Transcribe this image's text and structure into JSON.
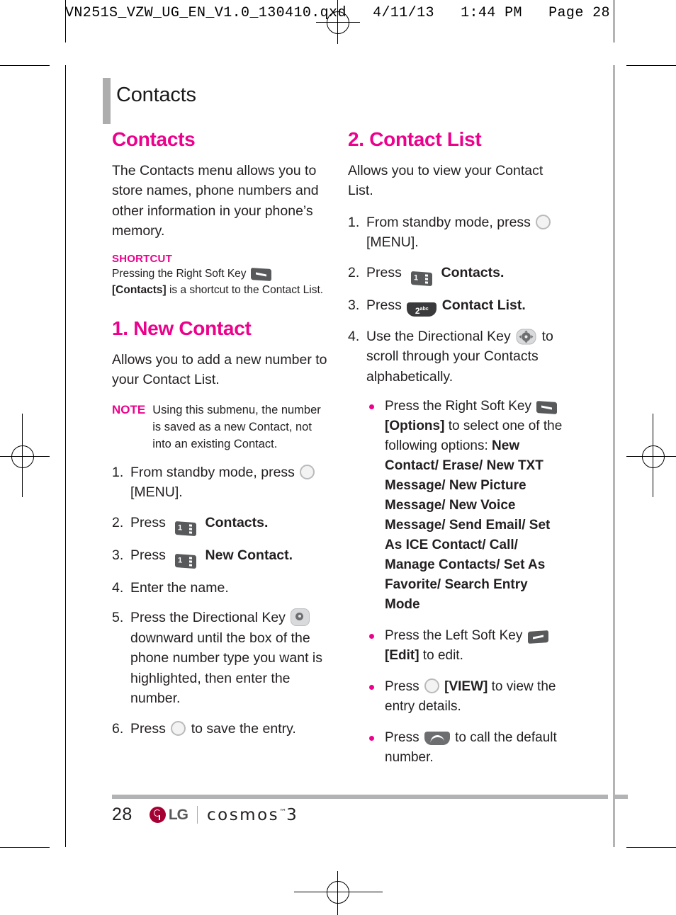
{
  "prepress": {
    "header": "VN251S_VZW_UG_EN_V1.0_130410.qxd   4/11/13   1:44 PM   Page 28"
  },
  "chapter": {
    "title": "Contacts"
  },
  "left_column": {
    "section_title": "Contacts",
    "intro": "The Contacts menu allows you to store names, phone numbers and other information in your phone’s memory.",
    "shortcut": {
      "label": "SHORTCUT",
      "text_before": "Pressing the Right Soft Key",
      "key_icon": "right-soft-key-icon",
      "bracket": "[Contacts]",
      "text_after": "is a shortcut to the Contact List."
    },
    "new_contact": {
      "heading": "1. New Contact",
      "intro": "Allows you to add a new number to your Contact List.",
      "note_label": "NOTE",
      "note_text": "Using this submenu, the number is saved as a new Contact, not into an existing Contact.",
      "steps": [
        {
          "num": "1.",
          "text_before": "From standby mode, press",
          "icon": "ok-key-icon",
          "text_after": "[MENU].",
          "bold_after": false
        },
        {
          "num": "2.",
          "text_before": "Press",
          "icon": "numeric-key-1-icon",
          "text_after": "Contacts.",
          "bold_after": true
        },
        {
          "num": "3.",
          "text_before": "Press",
          "icon": "numeric-key-1-icon",
          "text_after": "New Contact.",
          "bold_after": true
        },
        {
          "num": "4.",
          "text_before": "Enter the name.",
          "icon": "",
          "text_after": "",
          "bold_after": false
        },
        {
          "num": "5.",
          "text_before": "Press the Directional Key",
          "icon": "directional-key-icon",
          "text_after": "downward until the box of the phone number type you want is highlighted, then enter the number.",
          "bold_after": false
        },
        {
          "num": "6.",
          "text_before": "Press",
          "icon": "ok-key-icon",
          "text_after": "to save the entry.",
          "bold_after": false
        }
      ]
    }
  },
  "right_column": {
    "contact_list": {
      "heading": "2. Contact List",
      "intro": "Allows you to view your Contact List.",
      "steps": [
        {
          "num": "1.",
          "text_before": "From standby mode, press",
          "icon": "ok-key-icon",
          "text_after": "[MENU].",
          "bold_after": false
        },
        {
          "num": "2.",
          "text_before": "Press",
          "icon": "numeric-key-1-icon",
          "text_after": "Contacts.",
          "bold_after": true
        },
        {
          "num": "3.",
          "text_before": "Press",
          "icon": "numeric-key-2abc-icon",
          "text_after": "Contact List.",
          "bold_after": true
        },
        {
          "num": "4.",
          "text_before": "Use the Directional Key",
          "icon": "directional-key-4way-icon",
          "text_after": "to scroll through your Contacts alphabetically.",
          "bold_after": false
        }
      ],
      "bullets": [
        {
          "text_before": "Press the Right Soft Key",
          "icon": "right-soft-key-icon",
          "bracket": "[Options]",
          "text_after": "to select one of the following options:",
          "options_bold": "New Contact/ Erase/ New TXT Message/ New Picture Message/ New Voice Message/ Send Email/ Set As ICE Contact/ Call/ Manage Contacts/ Set As Favorite/ Search Entry Mode"
        },
        {
          "text_before": "Press the Left Soft Key",
          "icon": "left-soft-key-icon",
          "bracket": "[Edit]",
          "text_after": "to edit.",
          "options_bold": ""
        },
        {
          "text_before": "Press",
          "icon": "ok-key-icon",
          "bracket": "[VIEW]",
          "text_after": "to view the entry details.",
          "options_bold": ""
        },
        {
          "text_before": "Press",
          "icon": "call-key-icon",
          "bracket": "",
          "text_after": "to call the default number.",
          "options_bold": ""
        }
      ]
    }
  },
  "footer": {
    "page_number": "28",
    "brand": "LG",
    "product": "cosmos",
    "product_sup": "™",
    "product_suffix": "3"
  },
  "colors": {
    "accent_magenta": "#EC018C",
    "body_text": "#231F20",
    "chapter_bar_gray": "#ADADAD",
    "footer_rule_gray": "#B2B3B5",
    "key_dark": "#58595B",
    "lg_red": "#A50034"
  }
}
